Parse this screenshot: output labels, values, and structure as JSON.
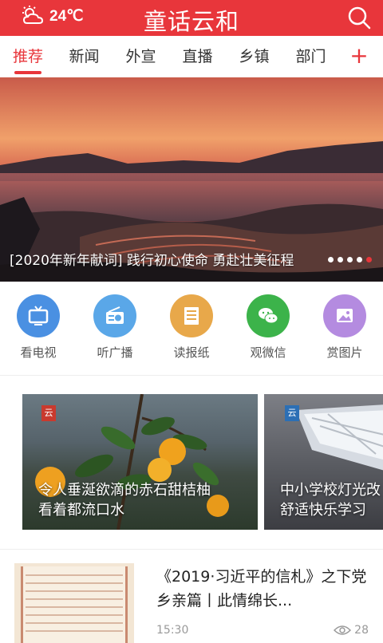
{
  "header": {
    "temperature": "24℃",
    "weather_icon": "partly-cloudy-icon",
    "app_title": "童话云和",
    "search_icon": "search-icon",
    "bg_color": "#e8363b"
  },
  "tabs": [
    {
      "label": "推荐",
      "active": true
    },
    {
      "label": "新闻",
      "active": false
    },
    {
      "label": "外宣",
      "active": false
    },
    {
      "label": "直播",
      "active": false
    },
    {
      "label": "乡镇",
      "active": false
    },
    {
      "label": "部门",
      "active": false
    }
  ],
  "tab_add": "+",
  "banner": {
    "caption": "[2020年新年献词] 践行初心使命  勇赴壮美征程",
    "dot_count": 5,
    "active_dot": 4
  },
  "quick_links": [
    {
      "label": "看电视",
      "icon": "tv-icon",
      "color": "#4a90e2"
    },
    {
      "label": "听广播",
      "icon": "radio-icon",
      "color": "#5aa7e8"
    },
    {
      "label": "读报纸",
      "icon": "newspaper-icon",
      "color": "#e8a84a"
    },
    {
      "label": "观微信",
      "icon": "wechat-icon",
      "color": "#3cb34a"
    },
    {
      "label": "赏图片",
      "icon": "picture-icon",
      "color": "#b48be0"
    }
  ],
  "cards": [
    {
      "title_line1": "令人垂涎欲滴的赤石甜桔柚",
      "title_line2": "看着都流口水"
    },
    {
      "title_line1": "中小学校灯光改",
      "title_line2": "舒适快乐学习"
    }
  ],
  "news": {
    "title": "《2019·习近平的信札》之下党乡亲篇丨此情绵长...",
    "time": "15:30",
    "views": "28"
  }
}
